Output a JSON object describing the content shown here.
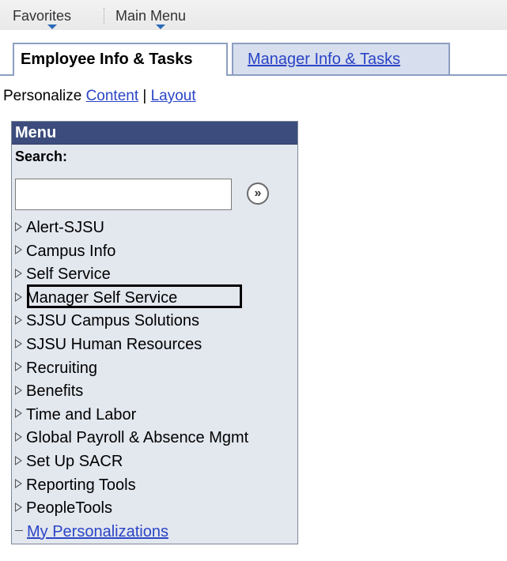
{
  "topbar": {
    "favorites_label": "Favorites",
    "main_menu_label": "Main Menu"
  },
  "tabs": [
    {
      "label": "Employee Info & Tasks",
      "active": true
    },
    {
      "label": "Manager Info & Tasks",
      "active": false
    }
  ],
  "personalize": {
    "prefix": "Personalize ",
    "content_link": "Content",
    "separator": " | ",
    "layout_link": "Layout"
  },
  "menu": {
    "title": "Menu",
    "search_label": "Search:",
    "search_value": "",
    "go_glyph": "»",
    "items": [
      {
        "label": "Alert-SJSU"
      },
      {
        "label": "Campus Info"
      },
      {
        "label": "Self Service"
      },
      {
        "label": "Manager Self Service"
      },
      {
        "label": "SJSU Campus Solutions"
      },
      {
        "label": "SJSU Human Resources"
      },
      {
        "label": "Recruiting"
      },
      {
        "label": "Benefits"
      },
      {
        "label": "Time and Labor"
      },
      {
        "label": "Global Payroll & Absence Mgmt"
      },
      {
        "label": "Set Up SACR"
      },
      {
        "label": "Reporting Tools"
      },
      {
        "label": "PeopleTools"
      }
    ],
    "personalizations_label": "My Personalizations"
  },
  "colors": {
    "header_bg": "#3c4d7d",
    "panel_bg": "#e3e7ee",
    "link": "#2a44c6",
    "tab_border": "#8d9ec1"
  }
}
